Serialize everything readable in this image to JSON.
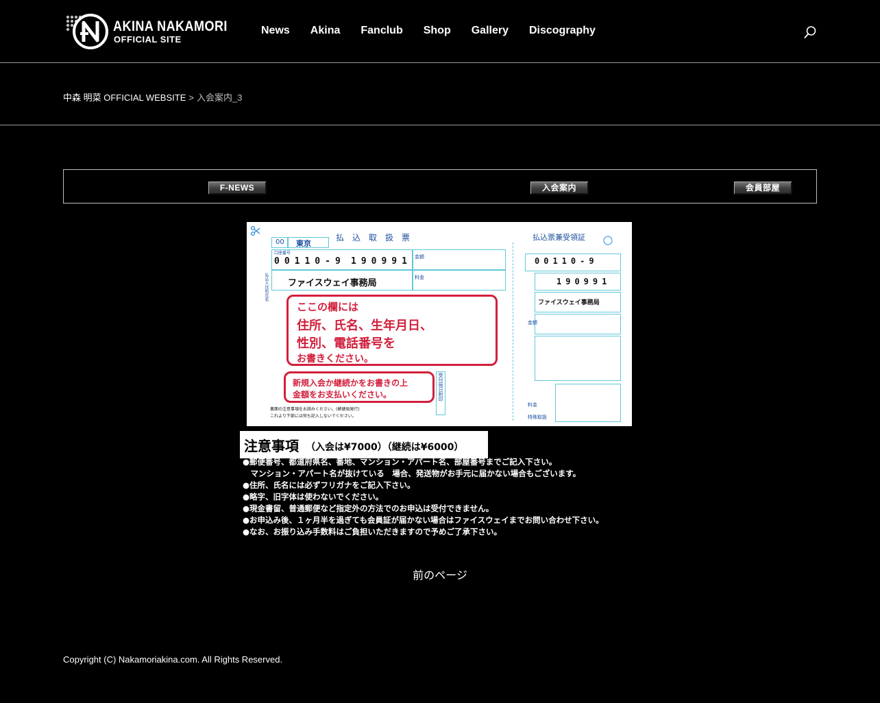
{
  "header": {
    "logo": {
      "name": "AKINA NAKAMORI",
      "subtitle": "OFFICIAL SITE"
    },
    "nav": [
      "News",
      "Akina",
      "Fanclub",
      "Shop",
      "Gallery",
      "Discography"
    ],
    "search_icon": "search-icon"
  },
  "breadcrumb": {
    "home": "中森 明菜 OFFICIAL WEBSITE",
    "separator": ">",
    "current": "入会案内_3"
  },
  "subnav": {
    "items": [
      "F-NEWS",
      "入会案内",
      "会員部屋"
    ]
  },
  "slip": {
    "title": "払　込　取　扱　票",
    "receipt_title": "払込票兼受領証",
    "region": "東京",
    "account_prefix": "00110-9",
    "account_number": "190991",
    "account_prefix_small": "00110-9",
    "account_number_small": "190991",
    "recipient": "ファイスウェイ事務局",
    "labels": {
      "account_no": "口座番号",
      "amount": "金額",
      "fee": "料金",
      "fee_special": "特殊取扱",
      "received_date": "受付局日附印",
      "payer": "払込人住所氏名"
    },
    "red_box_1": [
      "ここの欄には",
      "住所、氏名、生年月日、",
      "性別、電話番号を",
      "お書きください。"
    ],
    "red_box_2": [
      "新規入会か継続かをお書きの上",
      "金額をお支払いください。"
    ],
    "back_note": [
      "裏面の注意事項をお読みください。(郵便局発行)",
      "これより下部には何も記入しないでください。"
    ]
  },
  "notes": {
    "title": "注意事項",
    "price": "（入会は¥7000）（継続は¥6000）",
    "items": [
      "●郵便番号、都道府県名、番地、マンション・アパート名、部屋番号までご記入下さい。",
      "　マンション・アパート名が抜けている　場合、発送物がお手元に届かない場合もございます。",
      "●住所、氏名には必ずフリガナをご記入下さい。",
      "●略字、旧字体は使わないでください。",
      "●現金書留、普通郵便など指定外の方法でのお申込は受付できません。",
      "●お申込み後、１ヶ月半を過ぎても会員証が届かない場合はファイスウェイまでお問い合わせ下さい。",
      "●なお、お振り込み手数料はご負担いただきますので予めご了承下さい。"
    ]
  },
  "prev_page": "前のページ",
  "footer": {
    "copyright": "Copyright (C) Nakamoriakina.com. All Rights Reserved."
  }
}
